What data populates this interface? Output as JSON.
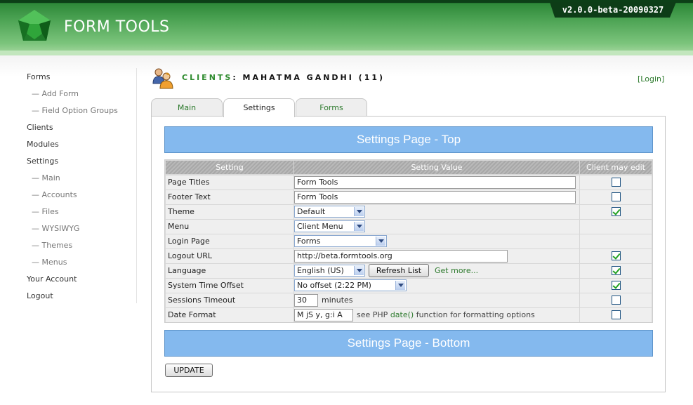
{
  "app": {
    "title": "FORM TOOLS",
    "version": "v2.0.0-beta-20090327"
  },
  "sidebar": {
    "items": [
      {
        "label": "Forms",
        "sub": false
      },
      {
        "label": "— Add Form",
        "sub": true
      },
      {
        "label": "— Field Option Groups",
        "sub": true
      },
      {
        "label": "Clients",
        "sub": false
      },
      {
        "label": "Modules",
        "sub": false
      },
      {
        "label": "Settings",
        "sub": false
      },
      {
        "label": "— Main",
        "sub": true
      },
      {
        "label": "— Accounts",
        "sub": true
      },
      {
        "label": "— Files",
        "sub": true
      },
      {
        "label": "— WYSIWYG",
        "sub": true
      },
      {
        "label": "— Themes",
        "sub": true
      },
      {
        "label": "— Menus",
        "sub": true
      },
      {
        "label": "Your Account",
        "sub": false
      },
      {
        "label": "Logout",
        "sub": false
      }
    ]
  },
  "page": {
    "section": "CLIENTS",
    "title_rest": ": MAHATMA GANDHI (11)",
    "login_link": "[Login]"
  },
  "tabs": [
    {
      "label": "Main"
    },
    {
      "label": "Settings"
    },
    {
      "label": "Forms"
    }
  ],
  "settings": {
    "top_bar": "Settings Page - Top",
    "bottom_bar": "Settings Page - Bottom",
    "headers": {
      "setting": "Setting",
      "value": "Setting Value",
      "client_edit": "Client may edit"
    },
    "rows": {
      "page_titles": {
        "label": "Page Titles",
        "value": "Form Tools",
        "editable": false
      },
      "footer_text": {
        "label": "Footer Text",
        "value": "Form Tools",
        "editable": false
      },
      "theme": {
        "label": "Theme",
        "value": "Default",
        "editable": true
      },
      "menu": {
        "label": "Menu",
        "value": "Client Menu"
      },
      "login_page": {
        "label": "Login Page",
        "value": "Forms"
      },
      "logout_url": {
        "label": "Logout URL",
        "value": "http://beta.formtools.org",
        "editable": true
      },
      "language": {
        "label": "Language",
        "value": "English (US)",
        "refresh": "Refresh List",
        "get_more": "Get more...",
        "editable": true
      },
      "time_offset": {
        "label": "System Time Offset",
        "value": "No offset (2:22 PM)",
        "editable": true
      },
      "sessions_timeout": {
        "label": "Sessions Timeout",
        "value": "30",
        "unit": "minutes",
        "editable": false
      },
      "date_format": {
        "label": "Date Format",
        "value": "M jS y, g:i A",
        "see_pre": "see PHP",
        "func": "date()",
        "see_post": "function for formatting options",
        "editable": false
      }
    },
    "update_button": "UPDATE"
  },
  "colors": {
    "header_green": "#4fa556",
    "bar_blue": "#84b9ee",
    "link_green": "#2d7a2d",
    "check_green": "#21a121"
  },
  "icons": {
    "logo": "green-gem-logo",
    "clients": "users-icon"
  }
}
